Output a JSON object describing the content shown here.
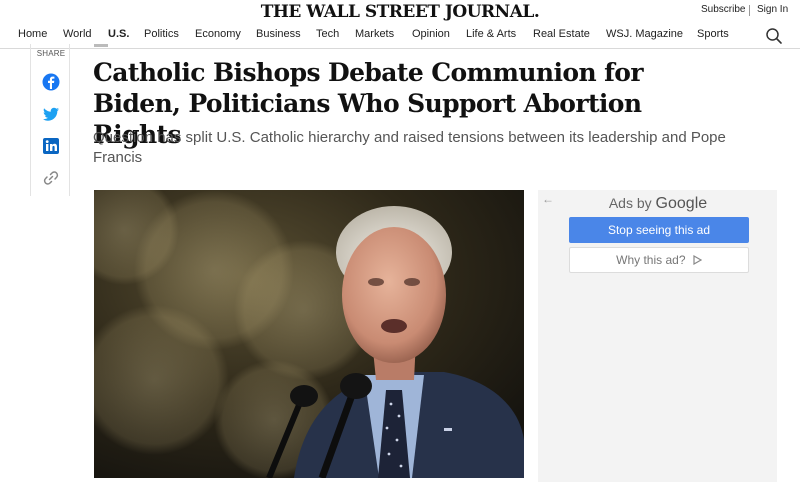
{
  "masthead": {
    "logo": "THE WALL STREET JOURNAL.",
    "subscribe": "Subscribe",
    "sign_in": "Sign In"
  },
  "nav": {
    "items": [
      "Home",
      "World",
      "U.S.",
      "Politics",
      "Economy",
      "Business",
      "Tech",
      "Markets",
      "Opinion",
      "Life & Arts",
      "Real Estate",
      "WSJ. Magazine",
      "Sports"
    ],
    "active": "U.S.",
    "search_icon": "search-icon"
  },
  "share": {
    "label": "SHARE",
    "icons": [
      "facebook-icon",
      "twitter-icon",
      "linkedin-icon",
      "link-icon"
    ],
    "colors": {
      "facebook": "#1877f2",
      "twitter": "#1da1f2",
      "linkedin": "#0a66c2",
      "link": "#888888"
    }
  },
  "article": {
    "headline": "Catholic Bishops Debate Communion for Biden, Politicians Who Support Abortion Rights",
    "dek": "Question has split U.S. Catholic hierarchy and raised tensions between its leadership and Pope Francis"
  },
  "ad": {
    "ads_by": "Ads by",
    "google": "Google",
    "stop_label": "Stop seeing this ad",
    "why_label": "Why this ad?",
    "button_color": "#4a86e8"
  }
}
